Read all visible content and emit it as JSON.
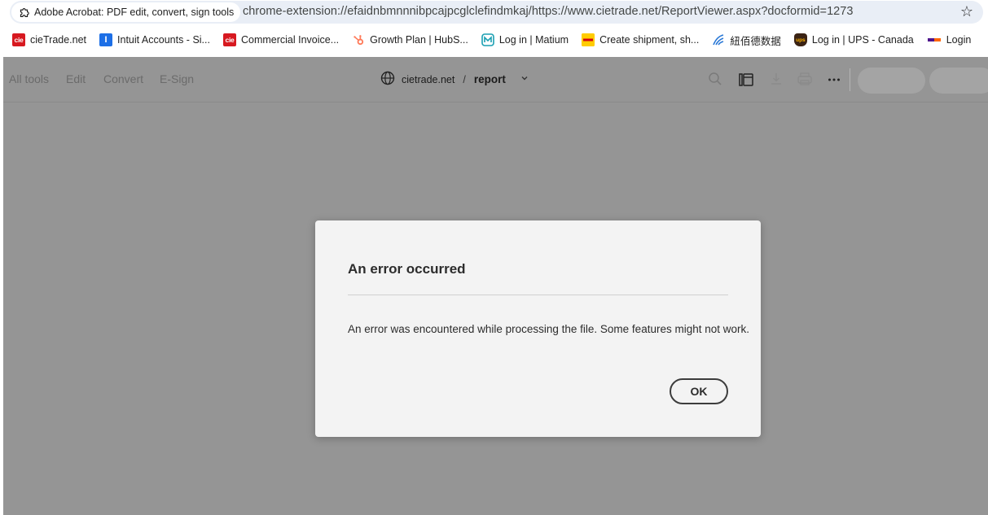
{
  "browser": {
    "site_chip": {
      "icon": "extension-page-icon",
      "label": "Adobe Acrobat: PDF edit, convert, sign tools"
    },
    "url": "chrome-extension://efaidnbmnnnibpcajpcglclefindmkaj/https://www.cietrade.net/ReportViewer.aspx?docformid=1273",
    "bookmark_star_icon": "star-outline-icon"
  },
  "bookmarks": [
    {
      "label": "cieTrade.net",
      "icon": "cietrade-icon",
      "fav": "cie"
    },
    {
      "label": "Intuit Accounts - Si...",
      "icon": "intuit-icon",
      "fav": "I"
    },
    {
      "label": "Commercial Invoice...",
      "icon": "cietrade-icon",
      "fav": "cie"
    },
    {
      "label": "Growth Plan | HubS...",
      "icon": "hubspot-icon",
      "fav": ""
    },
    {
      "label": "Log in | Matium",
      "icon": "matium-icon",
      "fav": ""
    },
    {
      "label": "Create shipment, sh...",
      "icon": "dhl-icon",
      "fav": ""
    },
    {
      "label": "紐佰德数据",
      "icon": "newbridge-icon",
      "fav": ""
    },
    {
      "label": "Log in | UPS - Canada",
      "icon": "ups-icon",
      "fav": "ups"
    },
    {
      "label": "Login",
      "icon": "fedex-icon",
      "fav": ""
    }
  ],
  "acrobat": {
    "tools": [
      "All tools",
      "Edit",
      "Convert",
      "E-Sign"
    ],
    "doc": {
      "domain": "cietrade.net",
      "separator": "/",
      "name": "report"
    },
    "toolbar_icons": [
      "search-icon",
      "page-thumbnails-icon",
      "download-icon",
      "print-icon",
      "more-options-icon"
    ],
    "background_color": "#959595"
  },
  "dialog": {
    "title": "An error occurred",
    "message": "An error was encountered while processing the file. Some features might not work.",
    "ok_label": "OK"
  }
}
